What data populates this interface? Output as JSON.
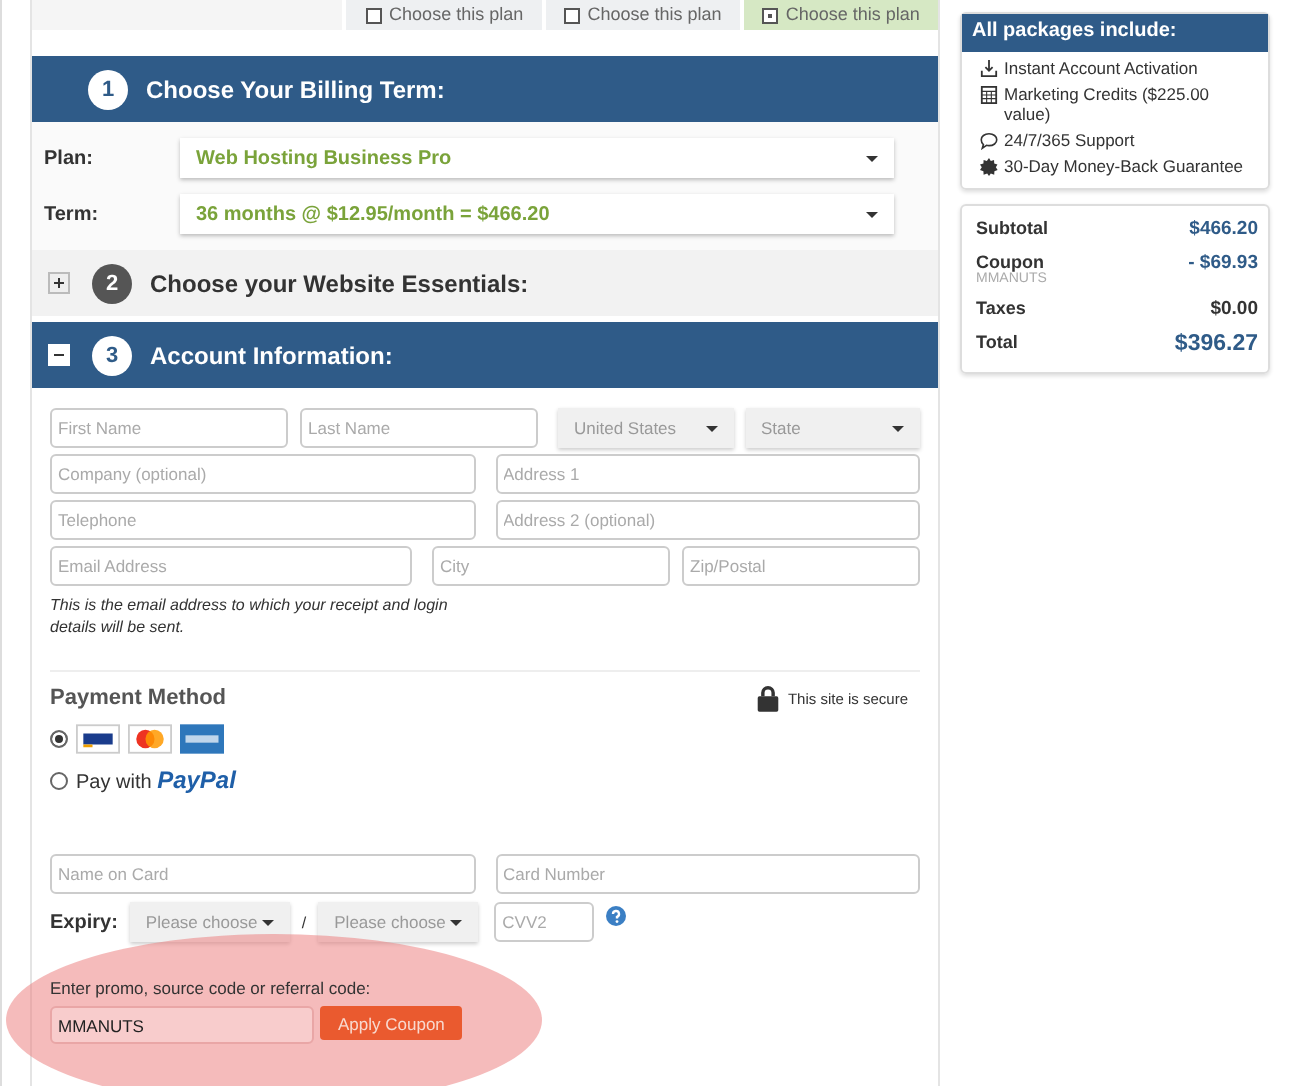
{
  "plan_tabs": [
    {
      "label": "Choose this plan",
      "selected": false
    },
    {
      "label": "Choose this plan",
      "selected": false
    },
    {
      "label": "Choose this plan",
      "selected": true
    }
  ],
  "billing": {
    "number": "1",
    "title": "Choose Your Billing Term:",
    "fields": [
      {
        "label": "Plan:",
        "value": "Web Hosting Business Pro"
      },
      {
        "label": "Term:",
        "value": "36 months @ $12.95/month = $466.20"
      }
    ]
  },
  "essentials": {
    "number": "2",
    "title": "Choose your Website Essentials:",
    "expanded": false
  },
  "account": {
    "number": "3",
    "title": "Account Information:",
    "expanded": true,
    "rows": [
      {
        "left": [
          {
            "kind": "input",
            "placeholder": "First Name"
          },
          {
            "kind": "input",
            "placeholder": "Last Name"
          }
        ],
        "right": [
          {
            "kind": "select",
            "value": "United States"
          },
          {
            "kind": "select",
            "value": "State"
          }
        ]
      },
      {
        "left": [
          {
            "kind": "input",
            "placeholder": "Company (optional)"
          }
        ],
        "right": [
          {
            "kind": "input",
            "placeholder": "Address 1"
          }
        ]
      },
      {
        "left": [
          {
            "kind": "input",
            "placeholder": "Telephone"
          }
        ],
        "right": [
          {
            "kind": "input",
            "placeholder": "Address 2 (optional)"
          }
        ]
      },
      {
        "left": [
          {
            "kind": "input",
            "placeholder": "Email Address"
          }
        ],
        "right": [
          {
            "kind": "input",
            "placeholder": "City"
          },
          {
            "kind": "input",
            "placeholder": "Zip/Postal"
          }
        ]
      }
    ],
    "email_note": "This is the email address to which your receipt and login details will be sent.",
    "payment_title": "Payment Method",
    "secure_note": "This site is secure",
    "methods": [
      {
        "kind": "cards",
        "selected": true
      },
      {
        "kind": "paypal",
        "selected": false,
        "label": "Pay with",
        "brand": "PayPal"
      }
    ],
    "card_fields": [
      {
        "placeholder": "Name on Card"
      },
      {
        "placeholder": "Card Number"
      }
    ],
    "expiry_label": "Expiry:",
    "expiry_month": "Please choose",
    "expiry_separator": "/",
    "expiry_year": "Please choose",
    "cvv_placeholder": "CVV2",
    "promo_label": "Enter promo, source code or referral code:",
    "promo_value": "MMANUTS",
    "promo_button": "Apply Coupon"
  },
  "includes": {
    "title": "All packages include:",
    "items": [
      "Instant Account Activation",
      "Marketing Credits ($225.00 value)",
      "24/7/365 Support",
      "30-Day Money-Back Guarantee"
    ]
  },
  "summary": [
    {
      "label": "Subtotal",
      "value": "$466.20",
      "highlighted": true
    },
    {
      "label": "Coupon",
      "sublabel": "MMANUTS",
      "value": "- $69.93",
      "highlighted": true
    },
    {
      "label": "Taxes",
      "value": "$0.00",
      "highlighted": false
    },
    {
      "label": "Total",
      "value": "$396.27",
      "highlighted": true,
      "large": true
    }
  ]
}
